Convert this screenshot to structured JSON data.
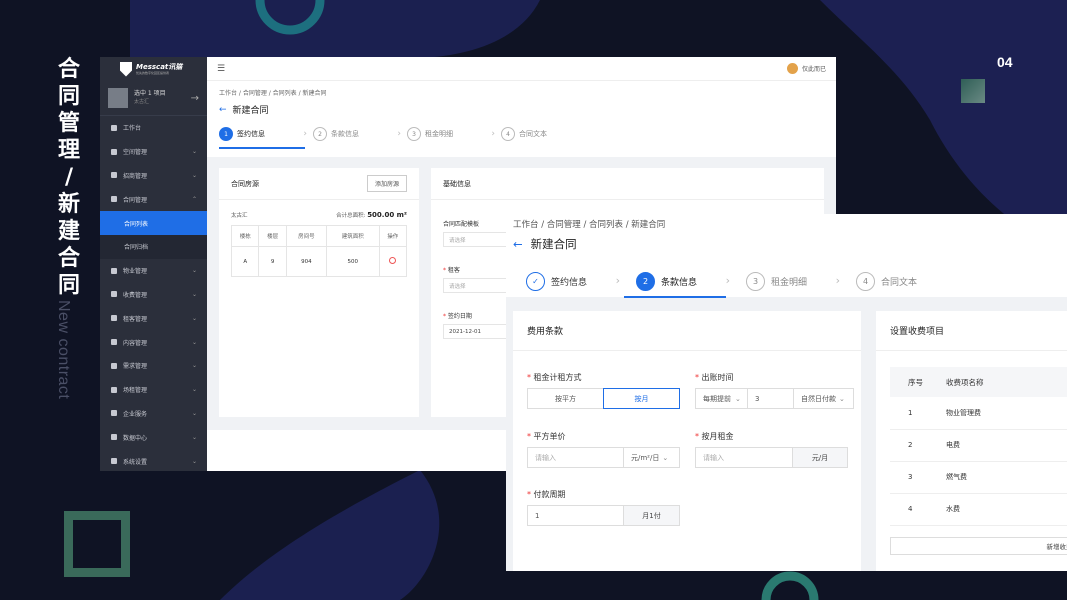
{
  "slide": {
    "title_chars": [
      "合",
      "同",
      "管",
      "理",
      "/",
      "新",
      "建",
      "合",
      "同"
    ],
    "subtitle": "New contract",
    "page_number": "04"
  },
  "win1": {
    "logo_title": "Messcat讯猫",
    "logo_sub": "优先的数字化园区提供者",
    "project": {
      "title": "选中 1 项目",
      "name": "太古汇"
    },
    "menu": [
      {
        "label": "工作台",
        "chevron": false
      },
      {
        "label": "空间管理",
        "chevron": true
      },
      {
        "label": "招商管理",
        "chevron": true
      },
      {
        "label": "合同管理",
        "chevron": true
      }
    ],
    "submenu": [
      {
        "label": "合同列表",
        "active": true
      },
      {
        "label": "合同归档",
        "active": false
      }
    ],
    "menu2": [
      "物业管理",
      "收费管理",
      "租客管理",
      "内容管理",
      "需求管理",
      "场租管理",
      "企业服务",
      "数据中心",
      "系统设置"
    ],
    "user": "仅此而已",
    "breadcrumb": "工作台 / 合同管理 / 合同列表 / 新建合同",
    "page_title": "新建合同",
    "steps": [
      {
        "num": "1",
        "label": "签约信息"
      },
      {
        "num": "2",
        "label": "条款信息"
      },
      {
        "num": "3",
        "label": "租金明细"
      },
      {
        "num": "4",
        "label": "合同文本"
      }
    ],
    "room_card": {
      "title": "合同房源",
      "add_button": "添加房源",
      "project_name": "太古汇",
      "area_label": "合计总面积:",
      "area_value": "500.00 m²",
      "columns": [
        "楼栋",
        "楼层",
        "房间号",
        "建筑面积",
        "操作"
      ],
      "rows": [
        [
          "A",
          "9",
          "904",
          "500"
        ]
      ]
    },
    "basic_card": {
      "title": "基础信息",
      "fields": [
        {
          "label": "合同匹配模板",
          "required": false,
          "value": "请选择"
        },
        {
          "label": "租客",
          "required": true,
          "value": "请选择"
        },
        {
          "label": "签约日期",
          "required": true,
          "value": "2021-12-01"
        }
      ]
    }
  },
  "win2": {
    "breadcrumb": "工作台 / 合同管理 / 合同列表 / 新建合同",
    "page_title": "新建合同",
    "steps": [
      {
        "num": "✓",
        "label": "签约信息"
      },
      {
        "num": "2",
        "label": "条款信息"
      },
      {
        "num": "3",
        "label": "租金明细"
      },
      {
        "num": "4",
        "label": "合同文本"
      }
    ],
    "fee_card": {
      "title": "费用条款",
      "rent_method_label": "租金计租方式",
      "rent_method_options": [
        "按平方",
        "按月"
      ],
      "billing_time_label": "出账时间",
      "billing_time_select": "每期提前",
      "billing_time_days": "3",
      "billing_time_unit": "自然日付款",
      "unit_price_label": "平方单价",
      "unit_price_placeholder": "请输入",
      "unit_price_unit": "元/m²/日",
      "monthly_rent_label": "按月租金",
      "monthly_rent_placeholder": "请输入",
      "monthly_rent_unit": "元/月",
      "pay_cycle_label": "付款周期",
      "pay_cycle_value": "1",
      "pay_cycle_unit": "月1付"
    },
    "charge_card": {
      "title": "设置收费项目",
      "columns": [
        "序号",
        "收费项名称"
      ],
      "rows": [
        [
          "1",
          "物业管理费"
        ],
        [
          "2",
          "电费"
        ],
        [
          "3",
          "燃气费"
        ],
        [
          "4",
          "水费"
        ]
      ],
      "add_button": "新增收费项"
    }
  }
}
